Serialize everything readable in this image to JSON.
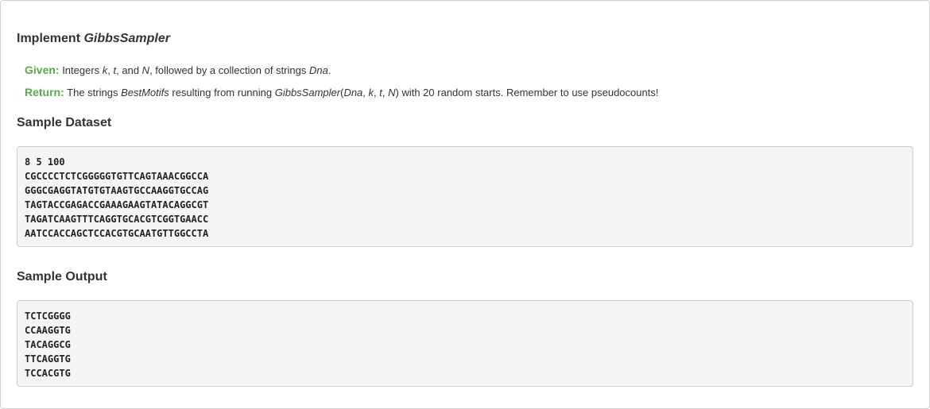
{
  "title": {
    "prefix": "Implement ",
    "name": "GibbsSampler"
  },
  "given": {
    "label": "Given:",
    "text_1": " Integers ",
    "var_k": "k",
    "sep_1": ", ",
    "var_t": "t",
    "sep_2": ", and ",
    "var_N": "N",
    "text_2": ", followed by a collection of strings ",
    "var_Dna": "Dna",
    "text_3": "."
  },
  "return": {
    "label": "Return:",
    "text_1": " The strings ",
    "var_best": "BestMotifs",
    "text_2": " resulting from running ",
    "func": "GibbsSampler",
    "paren_open": "(",
    "arg_dna": "Dna",
    "comma_1": ", ",
    "arg_k": "k",
    "comma_2": ", ",
    "arg_t": "t",
    "comma_3": ", ",
    "arg_N": "N",
    "text_3": ") with 20 random starts. Remember to use pseudocounts!"
  },
  "sample_dataset": {
    "heading": "Sample Dataset",
    "lines": [
      "8 5 100",
      "CGCCCCTCTCGGGGGTGTTCAGTAAACGGCCA",
      "GGGCGAGGTATGTGTAAGTGCCAAGGTGCCAG",
      "TAGTACCGAGACCGAAAGAAGTATACAGGCGT",
      "TAGATCAAGTTTCAGGTGCACGTCGGTGAACC",
      "AATCCACCAGCTCCACGTGCAATGTTGGCCTA"
    ]
  },
  "sample_output": {
    "heading": "Sample Output",
    "lines": [
      "TCTCGGGG",
      "CCAAGGTG",
      "TACAGGCG",
      "TTCAGGTG",
      "TCCACGTG"
    ]
  }
}
